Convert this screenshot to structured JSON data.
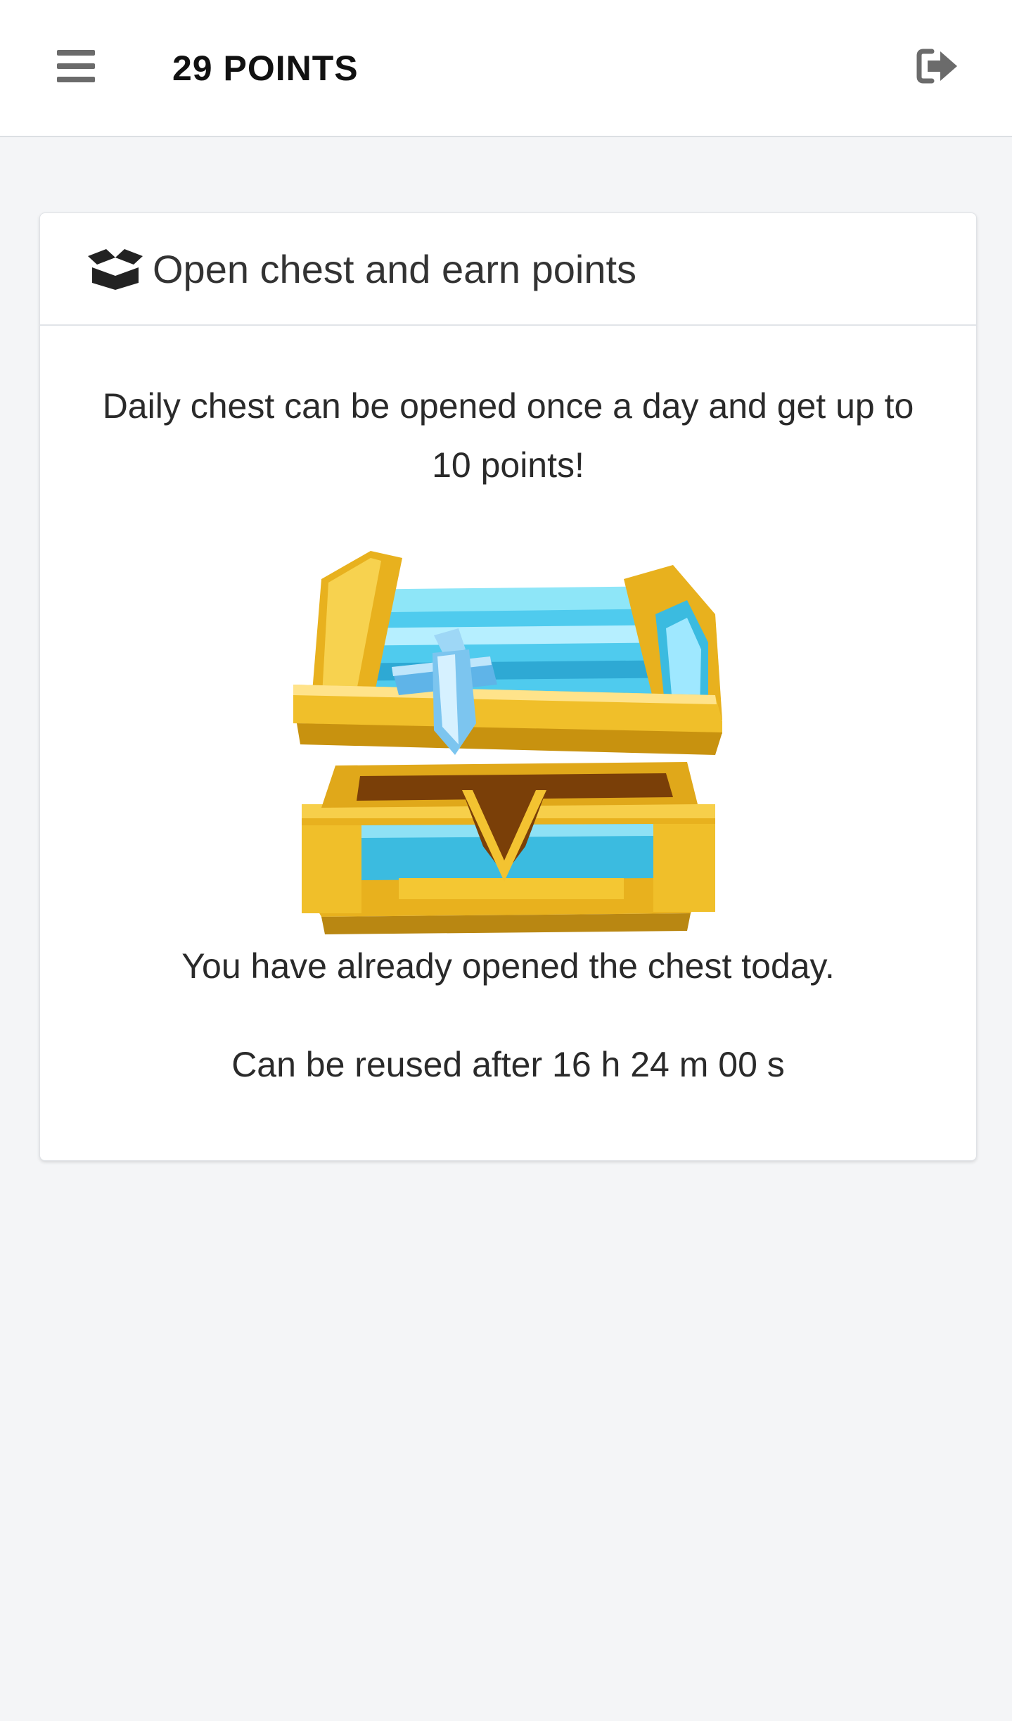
{
  "header": {
    "points_label": "29 POINTS",
    "menu_icon": "hamburger-icon",
    "logout_icon": "sign-out-icon"
  },
  "card": {
    "icon": "open-box-icon",
    "title": "Open chest and earn points",
    "description": "Daily chest can be opened once a day and get up to 10 points!",
    "status": "You have already opened the chest today.",
    "reuse_text": "Can be reused after 16 h 24 m 00 s"
  },
  "colors": {
    "background": "#f4f5f7",
    "card": "#ffffff",
    "icon_gray": "#6b6b6b",
    "chest_gold": "#e8b11e",
    "chest_blue": "#46c7e8"
  }
}
